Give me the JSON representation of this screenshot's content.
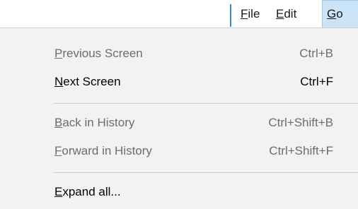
{
  "menubar": {
    "items": [
      {
        "label_first": "F",
        "label_rest": "ile"
      },
      {
        "label_first": "E",
        "label_rest": "dit"
      },
      {
        "label_first": "G",
        "label_rest": "o"
      }
    ]
  },
  "dropdown": {
    "items": [
      {
        "label_first": "P",
        "label_rest": "revious Screen",
        "shortcut": "Ctrl+B",
        "enabled": false
      },
      {
        "label_first": "N",
        "label_rest": "ext Screen",
        "shortcut": "Ctrl+F",
        "enabled": true
      },
      {
        "label_first": "B",
        "label_rest": "ack in History",
        "shortcut": "Ctrl+Shift+B",
        "enabled": false
      },
      {
        "label_first": "F",
        "label_rest": "orward in History",
        "shortcut": "Ctrl+Shift+F",
        "enabled": false
      },
      {
        "label_first": "E",
        "label_rest": "xpand all...",
        "shortcut": "",
        "enabled": true
      }
    ]
  },
  "colors": {
    "menu_background": "#f2f2f2",
    "active_menu_highlight": "#cce4f7",
    "disabled_text": "#6d6d6d",
    "accent_divider": "#3c8ad6"
  }
}
